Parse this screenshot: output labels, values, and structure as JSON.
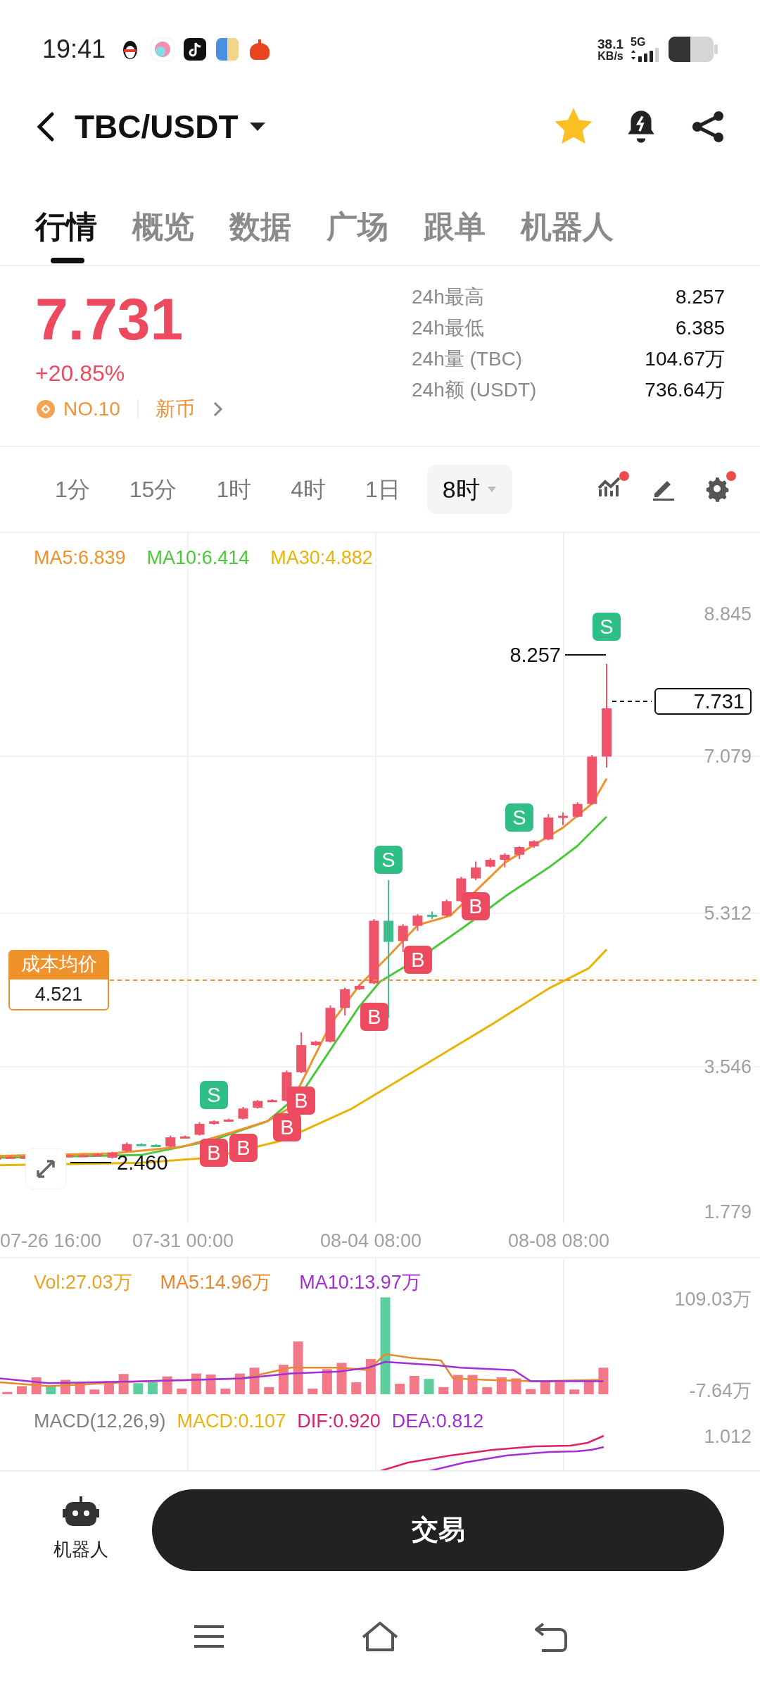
{
  "status_bar": {
    "time": "19:41",
    "net_speed": "38.1",
    "net_unit": "KB/s",
    "network": "5G"
  },
  "header": {
    "pair": "TBC/USDT",
    "favorite": true
  },
  "tabs": [
    {
      "label": "行情",
      "selected": true
    },
    {
      "label": "概览",
      "selected": false
    },
    {
      "label": "数据",
      "selected": false
    },
    {
      "label": "广场",
      "selected": false
    },
    {
      "label": "跟单",
      "selected": false
    },
    {
      "label": "机器人",
      "selected": false
    }
  ],
  "ticker": {
    "price": "7.731",
    "change": "+20.85%",
    "rank": "NO.10",
    "tag": "新币",
    "stats": [
      {
        "label": "24h最高",
        "value": "8.257"
      },
      {
        "label": "24h最低",
        "value": "6.385"
      },
      {
        "label": "24h量 (TBC)",
        "value": "104.67万"
      },
      {
        "label": "24h额 (USDT)",
        "value": "736.64万"
      }
    ]
  },
  "intervals": [
    {
      "label": "1分",
      "selected": false
    },
    {
      "label": "15分",
      "selected": false
    },
    {
      "label": "1时",
      "selected": false
    },
    {
      "label": "4时",
      "selected": false
    },
    {
      "label": "1日",
      "selected": false
    },
    {
      "label": "8时",
      "selected": true
    }
  ],
  "tools": [
    {
      "kind": "indicators",
      "badge": true
    },
    {
      "kind": "draw",
      "badge": false
    },
    {
      "kind": "settings",
      "badge": true
    }
  ],
  "chart": {
    "legend": [
      {
        "text": "MA5:6.839",
        "color": "#f0922c"
      },
      {
        "text": "MA10:6.414",
        "color": "#4cc93a"
      },
      {
        "text": "MA30:4.882",
        "color": "#eab308"
      }
    ],
    "y_axis": [
      "8.845",
      "7.079",
      "5.312",
      "3.546",
      "1.779"
    ],
    "x_axis": [
      "07-26 16:00",
      "07-31 00:00",
      "08-04 08:00",
      "08-08 08:00"
    ],
    "high_label": "8.257",
    "low_label": "2.460",
    "last_price": "7.731",
    "cost": {
      "title": "成本均价",
      "value": "4.521"
    },
    "markers": [
      {
        "label": "S",
        "kind": "sell"
      },
      {
        "label": "S",
        "kind": "sell"
      },
      {
        "label": "S",
        "kind": "sell"
      },
      {
        "label": "B",
        "kind": "buy"
      },
      {
        "label": "B",
        "kind": "buy"
      },
      {
        "label": "B",
        "kind": "buy"
      },
      {
        "label": "S",
        "kind": "sell"
      },
      {
        "label": "B",
        "kind": "buy"
      },
      {
        "label": "B",
        "kind": "buy"
      },
      {
        "label": "B",
        "kind": "buy"
      },
      {
        "label": "B",
        "kind": "buy"
      }
    ]
  },
  "volume": {
    "legend": [
      {
        "text": "Vol:27.03万",
        "color": "#eaa320"
      },
      {
        "text": "MA5:14.96万",
        "color": "#e8892c"
      },
      {
        "text": "MA10:13.97万",
        "color": "#a22fd6"
      }
    ],
    "y_axis": [
      "109.03万",
      "-7.64万"
    ]
  },
  "macd": {
    "legend": [
      {
        "text": "MACD(12,26,9)",
        "color": "#808080"
      },
      {
        "text": "MACD:0.107",
        "color": "#eab308"
      },
      {
        "text": "DIF:0.920",
        "color": "#e0206c"
      },
      {
        "text": "DEA:0.812",
        "color": "#a22fd6"
      }
    ],
    "y_axis": [
      "1.012"
    ]
  },
  "bottom_bar": {
    "robot_label": "机器人",
    "trade_button": "交易"
  }
}
